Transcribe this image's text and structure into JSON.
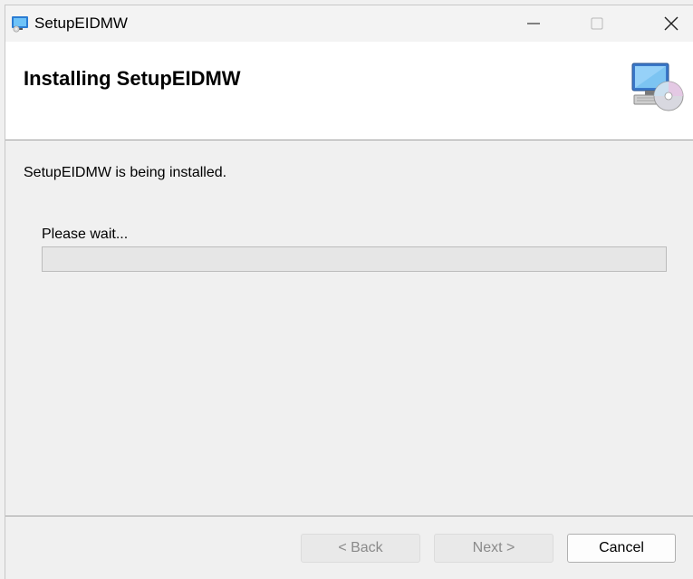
{
  "window": {
    "title": "SetupEIDMW",
    "controls": {
      "minimize": "minimize-icon",
      "maximize": "maximize-icon",
      "close": "close-icon"
    }
  },
  "header": {
    "title": "Installing SetupEIDMW",
    "icon": "computer-cd-icon"
  },
  "body": {
    "status_text": "SetupEIDMW is being installed.",
    "wait_label": "Please wait...",
    "progress": 0
  },
  "footer": {
    "back_label": "< Back",
    "next_label": "Next >",
    "cancel_label": "Cancel"
  },
  "colors": {
    "background": "#f0f0f0",
    "header_background": "#ffffff",
    "progress_track": "#e6e6e6",
    "progress_fill": "#06b025"
  }
}
